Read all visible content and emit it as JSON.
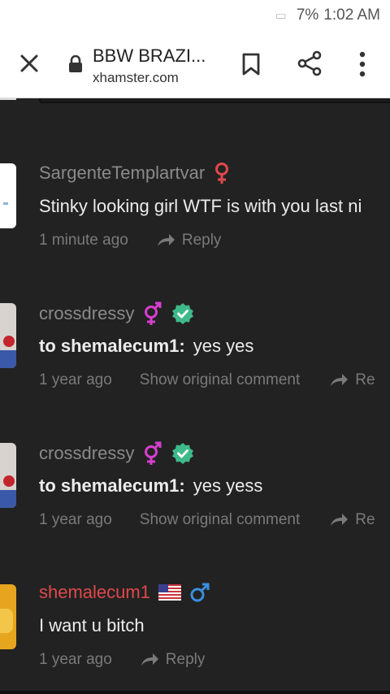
{
  "status": {
    "battery": "7%",
    "time": "1:02 AM"
  },
  "toolbar": {
    "title": "BBW BRAZI...",
    "url": "xhamster.com"
  },
  "comments": [
    {
      "username": "SargenteTemplartvar",
      "text": "Stinky looking girl WTF is with you last ni",
      "time": "1 minute ago",
      "reply": "Reply"
    },
    {
      "username": "crossdressy",
      "prefix": "to shemalecum1:",
      "text": "yes yes",
      "time": "1 year ago",
      "show_original": "Show original comment",
      "reply": "Re"
    },
    {
      "username": "crossdressy",
      "prefix": "to shemalecum1:",
      "text": "yes yess",
      "time": "1 year ago",
      "show_original": "Show original comment",
      "reply": "Re"
    },
    {
      "username": "shemalecum1",
      "text": "I want u bitch",
      "time": "1 year ago",
      "reply": "Reply"
    }
  ],
  "colors": {
    "background": "#222222",
    "username_gray": "#8a8a8a",
    "username_red": "#e0484b",
    "female_icon": "#e0484b",
    "trans_icon": "#d63fd0",
    "verified_badge": "#3fb98a",
    "male_icon": "#3a8fe0"
  }
}
